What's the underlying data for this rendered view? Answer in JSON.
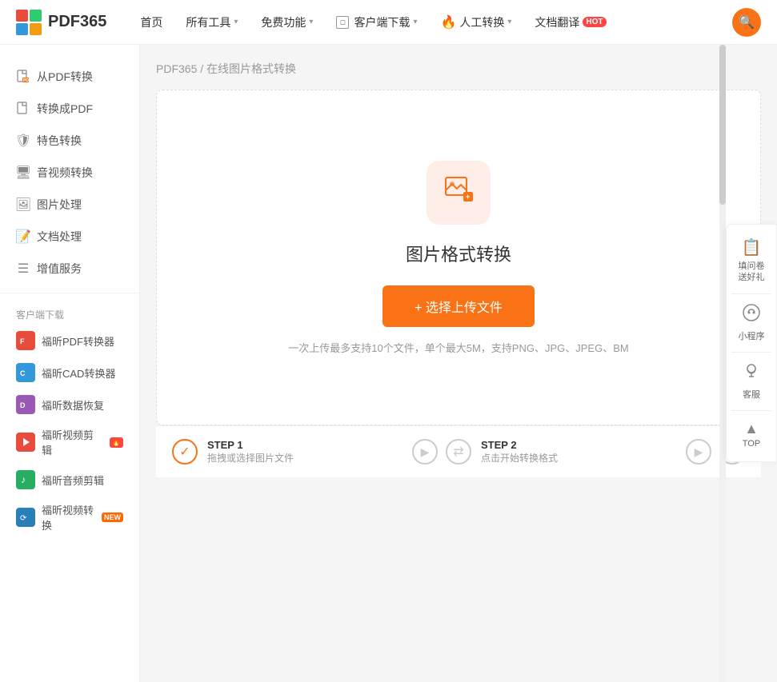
{
  "logo": {
    "text": "PDF365"
  },
  "nav": {
    "items": [
      {
        "label": "首页",
        "hasArrow": false
      },
      {
        "label": "所有工具",
        "hasArrow": true
      },
      {
        "label": "免费功能",
        "hasArrow": true
      },
      {
        "label": "客户端下载",
        "hasArrow": true,
        "hasIcon": true
      },
      {
        "label": "人工转换",
        "hasArrow": true,
        "hasFire": true
      },
      {
        "label": "文档翻译",
        "hasArrow": false,
        "hasBadge": true,
        "badge": "HOT"
      }
    ]
  },
  "sidebar": {
    "items": [
      {
        "label": "从PDF转换",
        "icon": "📄"
      },
      {
        "label": "转换成PDF",
        "icon": "📋"
      },
      {
        "label": "特色转换",
        "icon": "🛡"
      },
      {
        "label": "音视频转换",
        "icon": "🖥"
      },
      {
        "label": "图片处理",
        "icon": "🖼"
      },
      {
        "label": "文档处理",
        "icon": "📝"
      },
      {
        "label": "增值服务",
        "icon": "☰"
      }
    ],
    "client_label": "客户端下载",
    "apps": [
      {
        "label": "福昕PDF转换器",
        "color": "#e74c3c",
        "icon": "F",
        "badge": null
      },
      {
        "label": "福昕CAD转换器",
        "color": "#3498db",
        "icon": "C",
        "badge": null
      },
      {
        "label": "福昕数据恢复",
        "color": "#9b59b6",
        "icon": "D",
        "badge": null
      },
      {
        "label": "福昕视频剪辑",
        "color": "#e74c3c",
        "icon": "▶",
        "badge": "hot"
      },
      {
        "label": "福昕音频剪辑",
        "color": "#27ae60",
        "icon": "♪",
        "badge": null
      },
      {
        "label": "福昕视频转换",
        "color": "#2980b9",
        "icon": "⟳",
        "badge": "new"
      }
    ]
  },
  "breadcrumb": {
    "root": "PDF365",
    "separator": "/",
    "current": "在线图片格式转换"
  },
  "tool": {
    "title": "图片格式转换",
    "upload_label": "+ 选择上传文件",
    "hint": "一次上传最多支持10个文件，单个最大5M，支持PNG、JPG、JPEG、BM"
  },
  "steps": [
    {
      "num": "STEP 1",
      "desc": "拖拽或选择图片文件"
    },
    {
      "num": "STEP 2",
      "desc": "点击开始转换格式"
    }
  ],
  "right_panel": {
    "survey": "填问卷\n送好礼",
    "mini": "小程序",
    "service": "客服",
    "top": "TOP"
  }
}
